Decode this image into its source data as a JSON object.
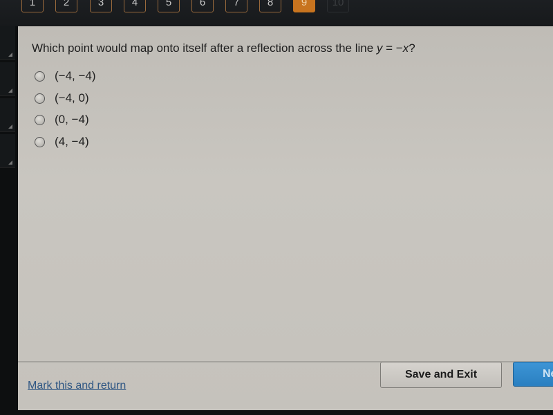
{
  "nav": {
    "questions": [
      {
        "label": "1",
        "state": "normal"
      },
      {
        "label": "2",
        "state": "normal"
      },
      {
        "label": "3",
        "state": "normal"
      },
      {
        "label": "4",
        "state": "normal"
      },
      {
        "label": "5",
        "state": "normal"
      },
      {
        "label": "6",
        "state": "normal"
      },
      {
        "label": "7",
        "state": "normal"
      },
      {
        "label": "8",
        "state": "normal"
      },
      {
        "label": "9",
        "state": "active"
      },
      {
        "label": "10",
        "state": "disabled"
      }
    ],
    "active_color": "#c8741f"
  },
  "question": {
    "text_prefix": "Which point would map onto itself after a reflection across the line ",
    "equation_var": "y",
    "equation_rest": " = −",
    "equation_var2": "x",
    "text_suffix": "?",
    "options": [
      {
        "label": "(−4, −4)",
        "selected": false
      },
      {
        "label": "(−4, 0)",
        "selected": false
      },
      {
        "label": "(0, −4)",
        "selected": false
      },
      {
        "label": "(4, −4)",
        "selected": false
      }
    ]
  },
  "footer": {
    "mark_link": "Mark this and return",
    "save_exit": "Save and Exit",
    "next": "Next",
    "next_color": "#2f87c9"
  }
}
